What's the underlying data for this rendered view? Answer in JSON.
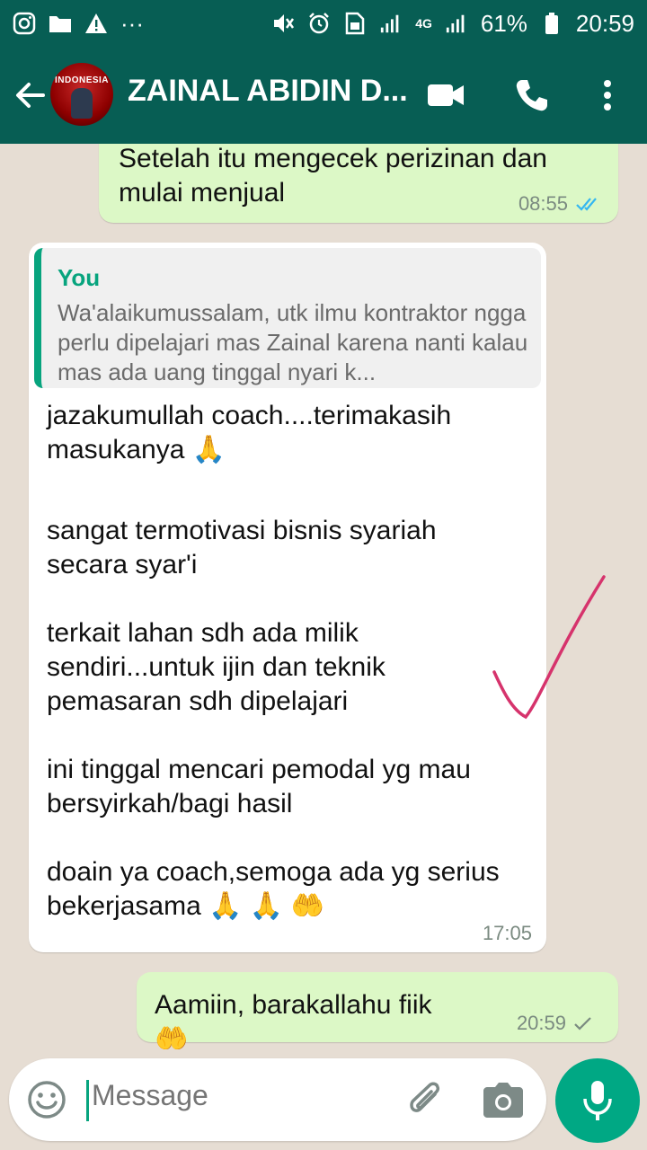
{
  "status_bar": {
    "battery_percent": "61%",
    "time": "20:59",
    "network": "4G",
    "overflow_dots": "···",
    "icons": [
      "instagram-icon",
      "folder-icon",
      "warning-icon",
      "mute-icon",
      "alarm-icon",
      "sim-icon",
      "signal-icon",
      "battery-icon"
    ]
  },
  "header": {
    "contact_name": "ZAINAL ABIDIN D...",
    "avatar_text": "INDONESIA",
    "icons": [
      "back-arrow-icon",
      "video-call-icon",
      "phone-icon",
      "more-vert-icon"
    ]
  },
  "messages": [
    {
      "direction": "outgoing",
      "text": "Setelah itu mengecek perizinan dan mulai menjual",
      "time": "08:55",
      "status": "read"
    },
    {
      "direction": "incoming",
      "quote": {
        "author": "You",
        "text": "Wa'alaikumussalam, utk ilmu kontraktor ngga perlu dipelajari mas Zainal karena nanti kalau mas ada uang tinggal nyari k..."
      },
      "paragraphs": [
        "jazakumullah coach....terimakasih masukanya 🙏",
        "sangat termotivasi bisnis syariah secara syar'i",
        "terkait lahan sdh ada milik sendiri...untuk ijin dan teknik pemasaran sdh dipelajari",
        "ini tinggal mencari pemodal yg mau bersyirkah/bagi hasil",
        "doain ya coach,semoga ada yg serius bekerjasama 🙏 🙏 🤲"
      ],
      "time": "17:05"
    },
    {
      "direction": "outgoing",
      "text": "Aamiin, barakallahu fiik 🤲",
      "time": "20:59",
      "status": "sent"
    }
  ],
  "input": {
    "placeholder": "Message",
    "icons": [
      "emoji-icon",
      "attach-icon",
      "camera-icon",
      "mic-icon"
    ]
  },
  "colors": {
    "header": "#075e54",
    "outgoing_bubble": "#dcf8c6",
    "incoming_bubble": "#ffffff",
    "accent": "#07a47e",
    "read_ticks": "#34b7f1",
    "annotation_check": "#d6336c"
  }
}
